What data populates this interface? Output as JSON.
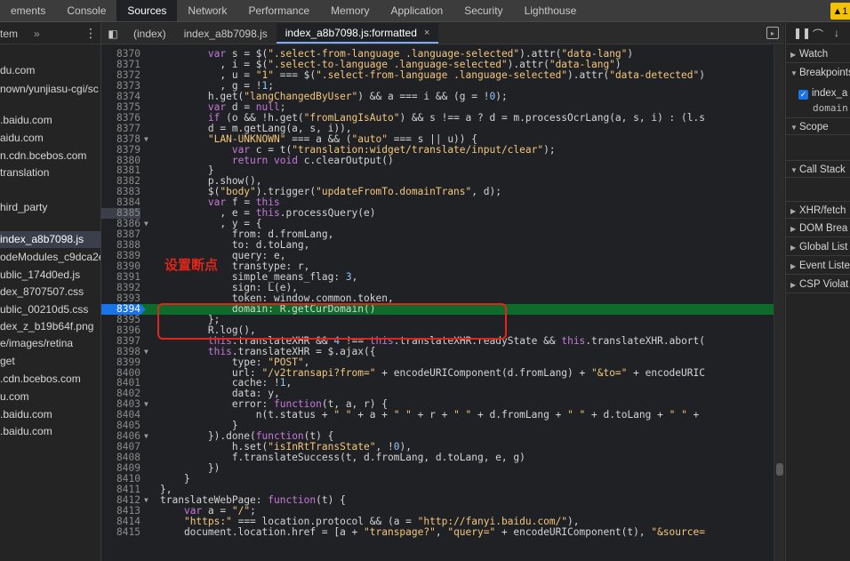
{
  "main_tabs": [
    "ements",
    "Console",
    "Sources",
    "Network",
    "Performance",
    "Memory",
    "Application",
    "Security",
    "Lighthouse"
  ],
  "active_main_tab": "Sources",
  "warning_badge": "▲1",
  "navigator": {
    "header_label": "tem",
    "more": "»",
    "menu": "⋮",
    "files": [
      "du.com",
      "nown/yunjiasu-cgi/sc",
      ".baidu.com",
      "aidu.com",
      "n.cdn.bcebos.com",
      "translation",
      "hird_party",
      "index_a8b7098.js",
      "odeModules_c9dca2e",
      "ublic_174d0ed.js",
      "dex_8707507.css",
      "ublic_00210d5.css",
      "dex_z_b19b64f.png",
      "e/images/retina",
      "get",
      ".cdn.bcebos.com",
      "u.com",
      ".baidu.com",
      ".baidu.com"
    ],
    "selected_file": "index_a8b7098.js"
  },
  "editor_tabs": [
    {
      "label": "(index)"
    },
    {
      "label": "index_a8b7098.js"
    },
    {
      "label": "index_a8b7098.js:formatted",
      "close": "×"
    }
  ],
  "annotation": "设置断点",
  "code_lines": [
    {
      "n": "8370",
      "fold": "",
      "code": "        var s = $(\".select-from-language .language-selected\").attr(\"data-lang\")"
    },
    {
      "n": "8371",
      "fold": "",
      "code": "          , i = $(\".select-to-language .language-selected\").attr(\"data-lang\")"
    },
    {
      "n": "8372",
      "fold": "",
      "code": "          , u = \"1\" === $(\".select-from-language .language-selected\").attr(\"data-detected\")"
    },
    {
      "n": "8373",
      "fold": "",
      "code": "          , g = !1;"
    },
    {
      "n": "8374",
      "fold": "",
      "code": "        h.get(\"langChangedByUser\") && a === i && (g = !0);"
    },
    {
      "n": "8375",
      "fold": "",
      "code": "        var d = null;"
    },
    {
      "n": "8376",
      "fold": "",
      "code": "        if (o && !h.get(\"fromLangIsAuto\") && s !== a ? d = m.processOcrLang(a, s, i) : (l.s"
    },
    {
      "n": "8377",
      "fold": "",
      "code": "        d = m.getLang(a, s, i)),"
    },
    {
      "n": "8378",
      "fold": "▼",
      "code": "        \"LAN-UNKNOWN\" === a && (\"auto\" === s || u)) {"
    },
    {
      "n": "8379",
      "fold": "",
      "code": "            var c = t(\"translation:widget/translate/input/clear\");"
    },
    {
      "n": "8380",
      "fold": "",
      "code": "            return void c.clearOutput()"
    },
    {
      "n": "8381",
      "fold": "",
      "code": "        }"
    },
    {
      "n": "8382",
      "fold": "",
      "code": "        p.show(),"
    },
    {
      "n": "8383",
      "fold": "",
      "code": "        $(\"body\").trigger(\"updateFromTo.domainTrans\", d);"
    },
    {
      "n": "8384",
      "fold": "",
      "code": "        var f = this"
    },
    {
      "n": "8385",
      "fold": "",
      "code": "          , e = this.processQuery(e)"
    },
    {
      "n": "8386",
      "fold": "▼",
      "code": "          , y = {"
    },
    {
      "n": "8387",
      "fold": "",
      "code": "            from: d.fromLang,"
    },
    {
      "n": "8388",
      "fold": "",
      "code": "            to: d.toLang,"
    },
    {
      "n": "8389",
      "fold": "",
      "code": "            query: e,"
    },
    {
      "n": "8390",
      "fold": "",
      "code": "            transtype: r,"
    },
    {
      "n": "8391",
      "fold": "",
      "code": "            simple_means_flag: 3,"
    },
    {
      "n": "8392",
      "fold": "",
      "code": "            sign: L(e),"
    },
    {
      "n": "8393",
      "fold": "",
      "code": "            token: window.common.token,"
    },
    {
      "n": "8394",
      "fold": "",
      "code": "            domain: R.getCurDomain()"
    },
    {
      "n": "8395",
      "fold": "",
      "code": "        };"
    },
    {
      "n": "8396",
      "fold": "",
      "code": "        R.log(),"
    },
    {
      "n": "8397",
      "fold": "",
      "code": "        this.translateXHR && 4 !== this.translateXHR.readyState && this.translateXHR.abort("
    },
    {
      "n": "8398",
      "fold": "▼",
      "code": "        this.translateXHR = $.ajax({"
    },
    {
      "n": "8399",
      "fold": "",
      "code": "            type: \"POST\","
    },
    {
      "n": "8400",
      "fold": "",
      "code": "            url: \"/v2transapi?from=\" + encodeURIComponent(d.fromLang) + \"&to=\" + encodeURIC"
    },
    {
      "n": "8401",
      "fold": "",
      "code": "            cache: !1,"
    },
    {
      "n": "8402",
      "fold": "",
      "code": "            data: y,"
    },
    {
      "n": "8403",
      "fold": "▼",
      "code": "            error: function(t, a, r) {"
    },
    {
      "n": "8404",
      "fold": "",
      "code": "                n(t.status + \" \" + a + \" \" + r + \" \" + d.fromLang + \" \" + d.toLang + \" \" +"
    },
    {
      "n": "8405",
      "fold": "",
      "code": "            }"
    },
    {
      "n": "8406",
      "fold": "▼",
      "code": "        }).done(function(t) {"
    },
    {
      "n": "8407",
      "fold": "",
      "code": "            h.set(\"isInRtTransState\", !0),"
    },
    {
      "n": "8408",
      "fold": "",
      "code": "            f.translateSuccess(t, d.fromLang, d.toLang, e, g)"
    },
    {
      "n": "8409",
      "fold": "",
      "code": "        })"
    },
    {
      "n": "8410",
      "fold": "",
      "code": "    }"
    },
    {
      "n": "8411",
      "fold": "",
      "code": "},"
    },
    {
      "n": "8412",
      "fold": "▼",
      "code": "translateWebPage: function(t) {"
    },
    {
      "n": "8413",
      "fold": "",
      "code": "    var a = \"/\";"
    },
    {
      "n": "8414",
      "fold": "",
      "code": "    \"https:\" === location.protocol && (a = \"http://fanyi.baidu.com/\"),"
    },
    {
      "n": "8415",
      "fold": "",
      "code": "    document.location.href = [a + \"transpage?\", \"query=\" + encodeURIComponent(t), \"&source="
    }
  ],
  "breakpoint_line": "8394",
  "hover_line": "8385",
  "debugger": {
    "tools": [
      "❚❚",
      "⌒",
      "↓"
    ],
    "sections": [
      "Watch",
      "Breakpoints",
      "Scope",
      "Call Stack",
      "XHR/fetch",
      "DOM Brea",
      "Global List",
      "Event Liste",
      "CSP Violat"
    ],
    "breakpoint_file": "index_a",
    "breakpoint_code": "domain"
  }
}
